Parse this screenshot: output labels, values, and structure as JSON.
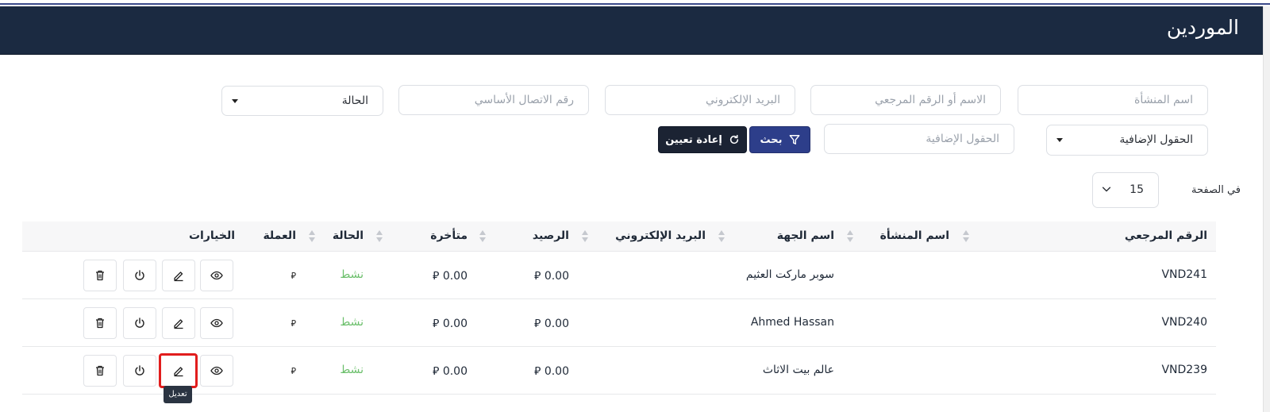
{
  "header": {
    "title": "الموردين"
  },
  "filters": {
    "facility_name_placeholder": "اسم المنشأة",
    "name_or_ref_placeholder": "الاسم أو الرقم المرجعي",
    "email_placeholder": "البريد الإلكتروني",
    "phone_placeholder": "رقم الاتصال الأساسي",
    "status_value": "الحالة",
    "extra_fields_select": "الحقول الإضافية",
    "extra_fields_placeholder": "الحقول الإضافية",
    "search_label": "بحث",
    "reset_label": "إعادة تعيين"
  },
  "pagination": {
    "per_page_label": "في الصفحة",
    "per_page_value": "15"
  },
  "table": {
    "columns": [
      "الرقم المرجعي",
      "اسم المنشأة",
      "اسم الجهة",
      "البريد الإلكتروني",
      "الرصيد",
      "متأخرة",
      "الحالة",
      "العملة",
      "الخيارات"
    ],
    "rows": [
      {
        "ref": "VND241",
        "facility": "",
        "contact": "سوبر ماركت العثيم",
        "email": "",
        "balance": "0.00 ⃁",
        "overdue": "0.00 ⃁",
        "status": "نشط",
        "currency": "⃁"
      },
      {
        "ref": "VND240",
        "facility": "",
        "contact": "Ahmed Hassan",
        "email": "",
        "balance": "0.00 ⃁",
        "overdue": "0.00 ⃁",
        "status": "نشط",
        "currency": "⃁"
      },
      {
        "ref": "VND239",
        "facility": "",
        "contact": "عالم بيت الاثاث",
        "email": "",
        "balance": "0.00 ⃁",
        "overdue": "0.00 ⃁",
        "status": "نشط",
        "currency": "⃁"
      }
    ]
  },
  "tooltip": {
    "text": "تعديل"
  },
  "icons": [
    "eye-icon",
    "pencil-icon",
    "power-icon",
    "trash-icon",
    "filter-icon",
    "refresh-icon",
    "chevron-down-icon",
    "sort-icon"
  ],
  "colors": {
    "header_bg": "#1b2a41",
    "search_btn": "#2d3e8a",
    "reset_btn": "#1b2333",
    "status_active": "#6bbf6b",
    "highlight": "#e11d1d"
  }
}
